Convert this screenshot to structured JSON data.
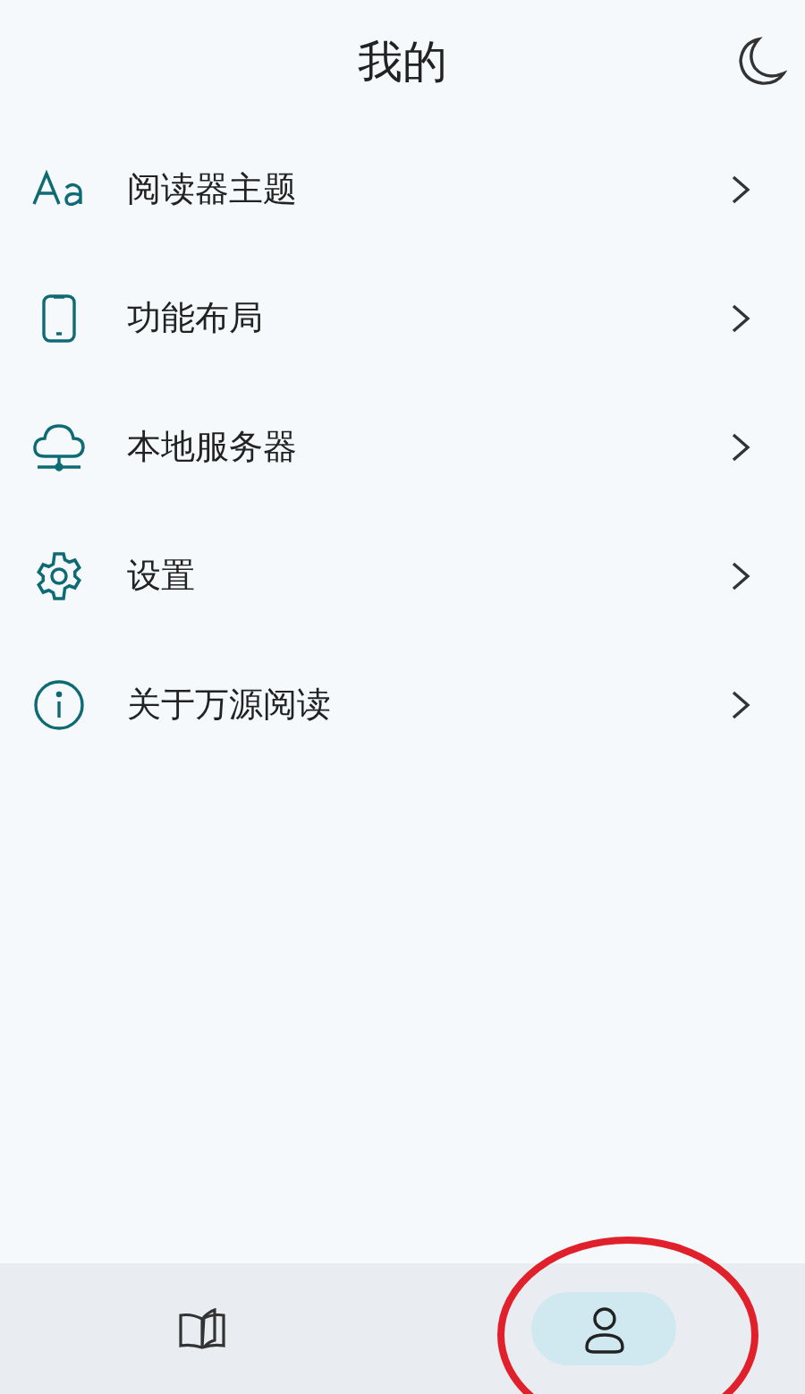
{
  "header": {
    "title": "我的"
  },
  "menu": [
    {
      "label": "阅读器主题"
    },
    {
      "label": "功能布局"
    },
    {
      "label": "本地服务器"
    },
    {
      "label": "设置"
    },
    {
      "label": "关于万源阅读"
    }
  ],
  "bottom_nav": [
    {
      "selected": false
    },
    {
      "selected": true
    }
  ]
}
